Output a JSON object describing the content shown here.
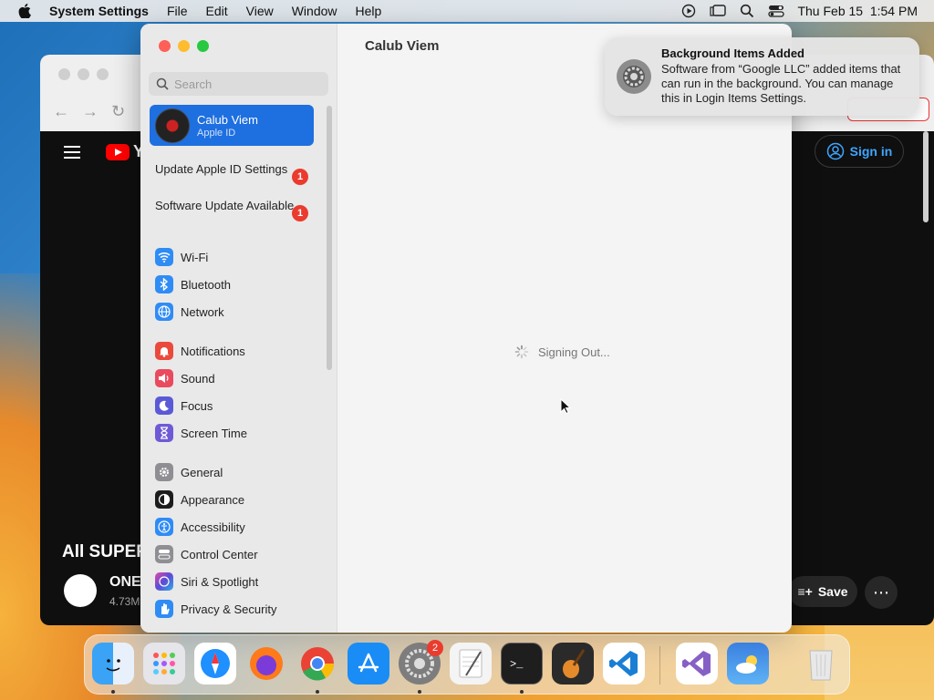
{
  "menubar": {
    "app_name": "System Settings",
    "menus": [
      "File",
      "Edit",
      "View",
      "Window",
      "Help"
    ],
    "datetime": "Thu Feb 15  1:54 PM"
  },
  "browser": {
    "yt_logo_text": "Y",
    "sign_in_label": "Sign in",
    "video_title": "All SUPER",
    "channel_name": "ONE",
    "channel_subs": "4.73M",
    "save_label": "Save"
  },
  "settings": {
    "search_placeholder": "Search",
    "account": {
      "name": "Calub Viem",
      "subtitle": "Apple ID"
    },
    "alerts": [
      {
        "label": "Update Apple ID Settings",
        "count": "1"
      },
      {
        "label": "Software Update Available",
        "count": "1"
      }
    ],
    "groups": [
      [
        {
          "label": "Wi-Fi",
          "icon": "wifi-icon",
          "color": "#2f8cf5"
        },
        {
          "label": "Bluetooth",
          "icon": "bluetooth-icon",
          "color": "#2f8cf5"
        },
        {
          "label": "Network",
          "icon": "globe-icon",
          "color": "#2f8cf5"
        }
      ],
      [
        {
          "label": "Notifications",
          "icon": "bell-icon",
          "color": "#ea4a3c"
        },
        {
          "label": "Sound",
          "icon": "speaker-icon",
          "color": "#ea4a5e"
        },
        {
          "label": "Focus",
          "icon": "moon-icon",
          "color": "#5b5ad6"
        },
        {
          "label": "Screen Time",
          "icon": "hourglass-icon",
          "color": "#6f5ad6"
        }
      ],
      [
        {
          "label": "General",
          "icon": "gear-icon",
          "color": "#8e8e93"
        },
        {
          "label": "Appearance",
          "icon": "appearance-icon",
          "color": "#1c1c1e"
        },
        {
          "label": "Accessibility",
          "icon": "accessibility-icon",
          "color": "#2f8cf5"
        },
        {
          "label": "Control Center",
          "icon": "control-center-icon",
          "color": "#8e8e93"
        },
        {
          "label": "Siri & Spotlight",
          "icon": "siri-icon",
          "color": "#6a4bd6"
        },
        {
          "label": "Privacy & Security",
          "icon": "hand-icon",
          "color": "#2f8cf5"
        }
      ]
    ],
    "content_title": "Calub Viem",
    "status_text": "Signing Out..."
  },
  "notification": {
    "title": "Background Items Added",
    "body": "Software from “Google LLC” added items that can run in the background. You can manage this in Login Items Settings."
  },
  "dock": {
    "items": [
      "Finder",
      "Launchpad",
      "Safari",
      "Firefox",
      "Chrome",
      "App Store",
      "System Settings",
      "TextEdit",
      "Terminal",
      "GarageBand",
      "Visual Studio Code",
      "Visual Studio",
      "Weather",
      "Trash"
    ],
    "settings_badge": "2"
  }
}
